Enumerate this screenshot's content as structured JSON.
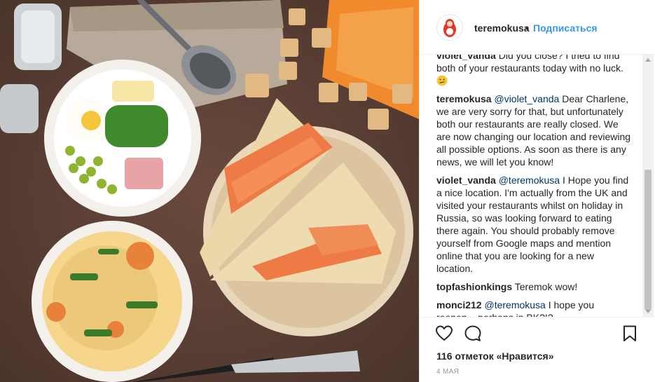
{
  "post": {
    "username": "teremokusa",
    "separator": "•",
    "follow_label": "Подписаться",
    "likes": "116 отметок «Нравится»",
    "date": "4 МАЯ"
  },
  "comments": [
    {
      "user": "violet_vanda",
      "mention": "",
      "text": "Did you close? I tried to find both of your restaurants today with no luck.",
      "emoji": "confused-face"
    },
    {
      "user": "teremokusa",
      "mention": "@violet_vanda",
      "text": "Dear Charlene, we are very sorry for that, but unfortunately both our restaurants are really closed. We are now changing our location and reviewing all possible options. As soon as there is any news, we will let you know!"
    },
    {
      "user": "violet_vanda",
      "mention": "@teremokusa",
      "text": "I Hope you find a nice location. I'm actually from the UK and visited your restaurants whilst on holiday in Russia, so was looking forward to eating there again. You should probably remove yourself from Google maps and mention online that you are looking for a new location."
    },
    {
      "user": "topfashionkings",
      "mention": "",
      "text": "Teremok wow!"
    },
    {
      "user": "monci212",
      "mention": "@teremokusa",
      "text": "I hope you reopen... perhaps in BK?!?"
    }
  ],
  "icons": {
    "like": "heart-outline-icon",
    "comment": "speech-bubble-icon",
    "save": "bookmark-icon"
  },
  "colors": {
    "link_blue": "#3897f0",
    "text": "#262626",
    "mention": "#003569",
    "muted": "#999999"
  }
}
